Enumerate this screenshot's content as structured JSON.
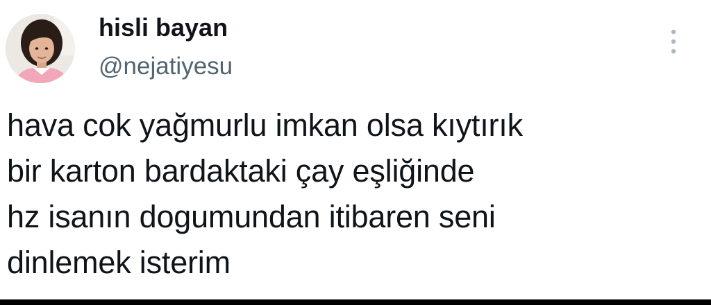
{
  "tweet": {
    "author": {
      "display_name": "hisli bayan",
      "handle": "@nejatiyesu",
      "avatar_icon": "profile-photo-girl"
    },
    "more_icon": "more-vertical-icon",
    "text_lines": [
      "hava cok yağmurlu imkan olsa kıytırık",
      "bir karton bardaktaki çay eşliğinde",
      "hz isanın dogumundan itibaren seni",
      "dinlemek isterim"
    ]
  },
  "colors": {
    "text_primary": "#0f1419",
    "text_secondary": "#536471",
    "icon_gray": "#aab8c2",
    "background": "#ffffff"
  }
}
